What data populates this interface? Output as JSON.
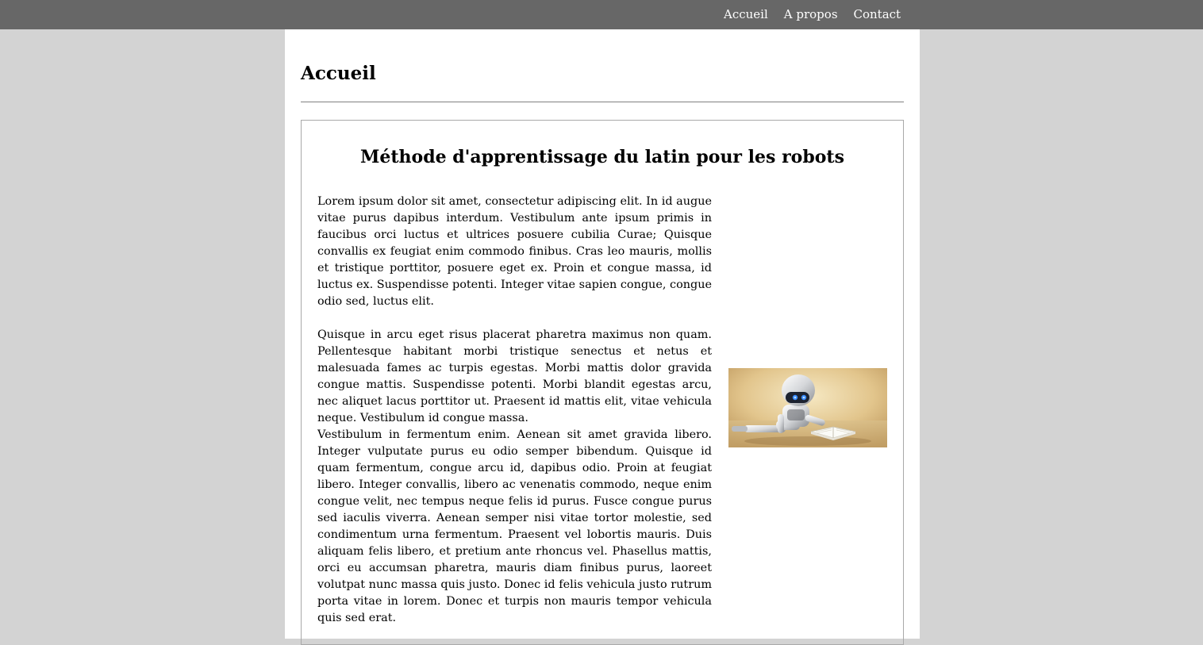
{
  "nav": {
    "items": [
      {
        "label": "Accueil"
      },
      {
        "label": "A propos"
      },
      {
        "label": "Contact"
      }
    ]
  },
  "page": {
    "title": "Accueil"
  },
  "article": {
    "title": "Méthode d'apprentissage du latin pour les robots",
    "paragraphs": [
      "Lorem ipsum dolor sit amet, consectetur adipiscing elit. In id augue vitae purus dapibus interdum. Vestibulum ante ipsum primis in faucibus orci luctus et ultrices posuere cubilia Curae; Quisque convallis ex feugiat enim commodo finibus. Cras leo mauris, mollis et tristique porttitor, posuere eget ex. Proin et congue massa, id luctus ex. Suspendisse potenti. Integer vitae sapien congue, congue odio sed, luctus elit.",
      "Quisque in arcu eget risus placerat pharetra maximus non quam. Pellentesque habitant morbi tristique senectus et netus et malesuada fames ac turpis egestas. Morbi mattis dolor gravida congue mattis. Suspendisse potenti. Morbi blandit egestas arcu, nec aliquet lacus porttitor ut. Praesent id mattis elit, vitae vehicula neque. Vestibulum id congue massa.",
      "Vestibulum in fermentum enim. Aenean sit amet gravida libero. Integer vulputate purus eu odio semper bibendum. Quisque id quam fermentum, congue arcu id, dapibus odio. Proin at feugiat libero. Integer convallis, libero ac venenatis commodo, neque enim congue velit, nec tempus neque felis id purus. Fusce congue purus sed iaculis viverra. Aenean semper nisi vitae tortor molestie, sed condimentum urna fermentum. Praesent vel lobortis mauris. Duis aliquam felis libero, et pretium ante rhoncus vel. Phasellus mattis, orci eu accumsan pharetra, mauris diam finibus purus, laoreet volutpat nunc massa quis justo. Donec id felis vehicula justo rutrum porta vitae in lorem. Donec et turpis non mauris tempor vehicula quis sed erat."
    ],
    "image": {
      "icon": "robot-reading-book-illustration"
    }
  },
  "colors": {
    "topbar": "#676767",
    "background": "#d3d3d3",
    "page": "#ffffff",
    "rule": "#808080",
    "card_border": "#a9a9a9"
  }
}
